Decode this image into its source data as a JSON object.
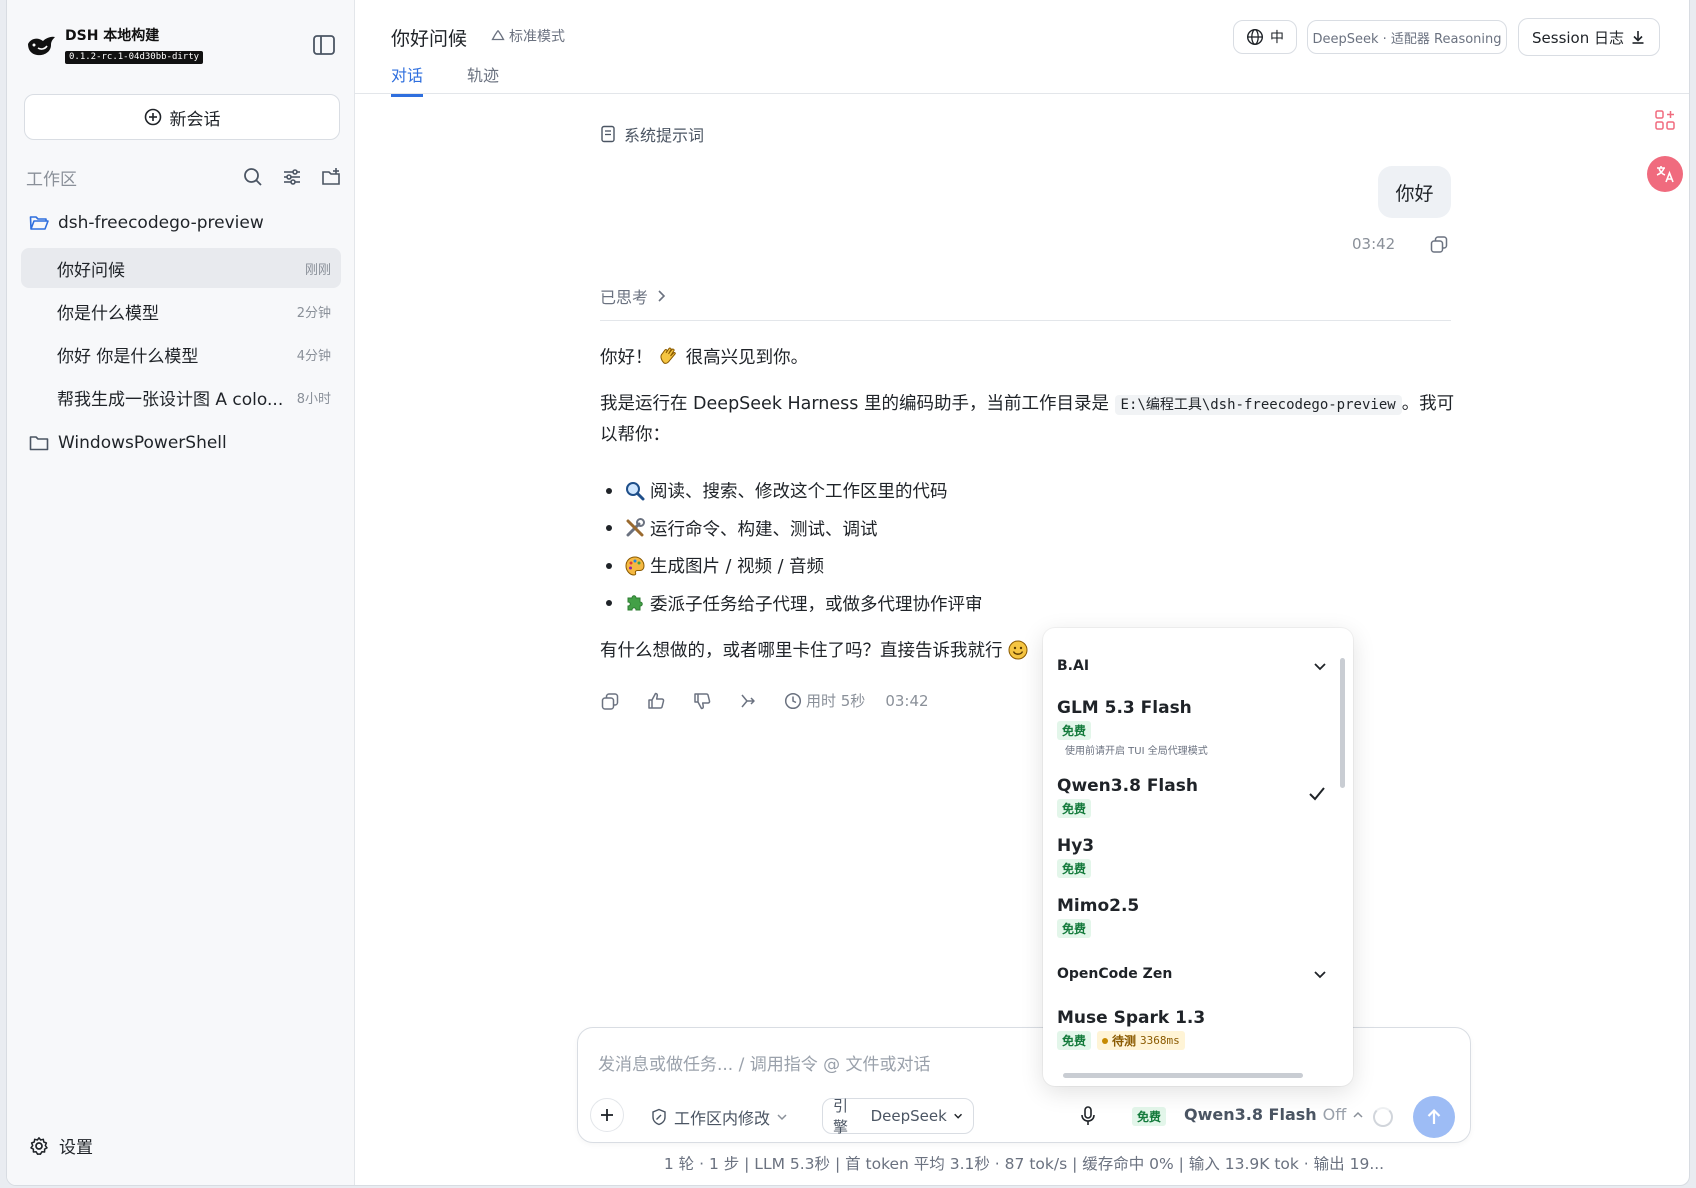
{
  "brand": {
    "name": "DSH 本地构建",
    "version": "0.1.2-rc.1-04d30bb-dirty"
  },
  "sidebar": {
    "new_chat": "新会话",
    "workspace_title": "工作区",
    "folders": [
      {
        "name": "dsh-freecodego-preview",
        "open": true
      },
      {
        "name": "WindowsPowerShell",
        "open": false
      }
    ],
    "chats": [
      {
        "label": "你好问候",
        "time": "刚刚",
        "active": true
      },
      {
        "label": "你是什么模型",
        "time": "2分钟"
      },
      {
        "label": "你好 你是什么模型",
        "time": "4分钟"
      },
      {
        "label": "帮我生成一张设计图 A colo...",
        "time": "8小时"
      }
    ],
    "settings": "设置"
  },
  "header": {
    "title": "你好问候",
    "mode": "标准模式",
    "tabs": [
      "对话",
      "轨迹"
    ],
    "lang": "中",
    "model_pill": "DeepSeek · 适配器 Reasoning",
    "session_log": "Session 日志"
  },
  "conversation": {
    "system_prompt": "系统提示词",
    "user_message": "你好",
    "user_time": "03:42",
    "thought_label": "已思考",
    "reply_greeting": "你好！",
    "reply_greeting_tail": "很高兴见到你。",
    "reply_intro_a": "我是运行在 DeepSeek Harness 里的编码助手，当前工作目录是",
    "reply_path": "E:\\编程工具\\dsh-freecodego-preview",
    "reply_intro_b": "。我可以帮你：",
    "bullets": [
      "阅读、搜索、修改这个工作区里的代码",
      "运行命令、构建、测试、调试",
      "生成图片 / 视频 / 音频",
      "委派子任务给子代理，或做多代理协作评审"
    ],
    "reply_outro": "有什么想做的，或者哪里卡住了吗？直接告诉我就行",
    "elapsed": "用时 5秒",
    "reply_time": "03:42"
  },
  "composer": {
    "placeholder": "发消息或做任务... / 调用指令 @ 文件或对话",
    "edit_mode": "工作区内修改",
    "engine_label": "引擎",
    "engine_value": "DeepSeek",
    "free_badge": "免费",
    "model": "Qwen3.8 Flash",
    "thinking": "Off"
  },
  "stats": "1 轮 · 1 步  |  LLM 5.3秒  |  首 token 平均 3.1秒 · 87 tok/s  |  缓存命中 0%  |  输入 13.9K tok · 输出 19...",
  "model_dropdown": {
    "groups": [
      {
        "name": "B.AI",
        "items": [
          {
            "name": "GLM 5.3 Flash",
            "badge": "免费",
            "note": "使用前请开启 TUI 全局代理模式"
          },
          {
            "name": "Qwen3.8 Flash",
            "badge": "免费",
            "selected": true
          },
          {
            "name": "Hy3",
            "badge": "免费"
          },
          {
            "name": "Mimo2.5",
            "badge": "免费"
          }
        ]
      },
      {
        "name": "OpenCode Zen",
        "items": [
          {
            "name": "Muse Spark 1.3",
            "badge": "免费",
            "status": "待测",
            "latency": "3368ms"
          }
        ]
      }
    ]
  },
  "colors": {
    "accent": "#2f6fde",
    "send": "#9dbcf5",
    "free_bg": "#e3f6ea",
    "free_fg": "#137a3b"
  }
}
